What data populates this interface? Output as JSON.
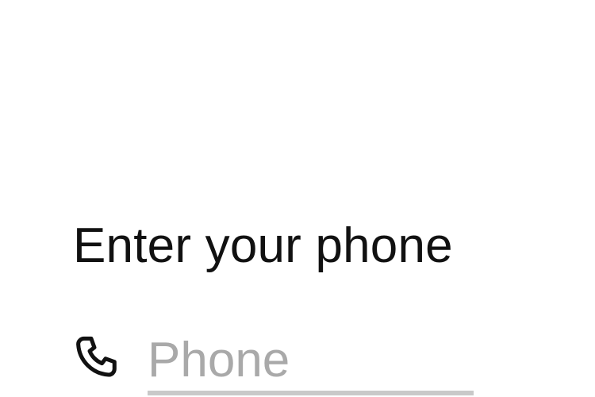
{
  "screen": {
    "title": "Enter your phone"
  },
  "phone_field": {
    "icon": "phone-icon",
    "placeholder": "Phone",
    "value": ""
  },
  "colors": {
    "text": "#111111",
    "placeholder": "#a9a9a9",
    "underline": "#c9c9c9",
    "background": "#ffffff"
  }
}
